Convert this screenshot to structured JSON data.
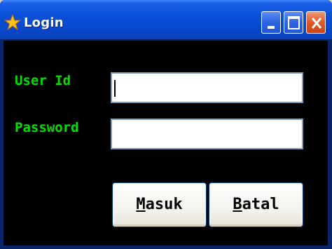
{
  "window": {
    "title": "Login",
    "icon": "star-icon",
    "controls": [
      "minimize-icon",
      "maximize-icon",
      "close-icon"
    ]
  },
  "form": {
    "user_label": "User Id",
    "user_value": "",
    "password_label": "Password",
    "password_value": ""
  },
  "buttons": {
    "ok_accel": "M",
    "ok_rest": "asuk",
    "cancel_accel": "B",
    "cancel_rest": "atal"
  },
  "colors": {
    "label": "#00e000",
    "background": "#000000",
    "titlebar": "#0846c9",
    "close": "#e25c2b"
  }
}
